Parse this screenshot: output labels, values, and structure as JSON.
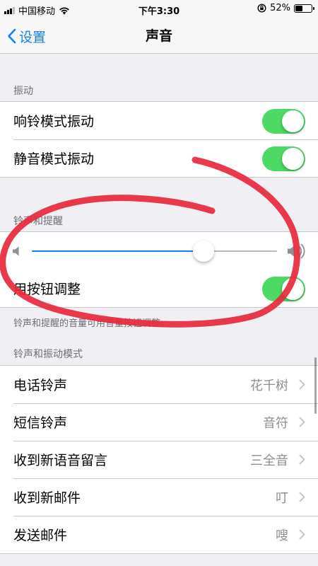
{
  "status_bar": {
    "carrier": "中国移动",
    "time": "下午3:30",
    "battery_percent": "52%",
    "battery_level": 0.52
  },
  "nav": {
    "back_label": "设置",
    "title": "声音"
  },
  "vibration": {
    "header": "振动",
    "items": [
      {
        "label": "响铃模式振动",
        "on": true
      },
      {
        "label": "静音模式振动",
        "on": true
      }
    ]
  },
  "ringer": {
    "header": "铃声和提醒",
    "volume_level": 0.7,
    "change_with_buttons_label": "用按钮调整",
    "change_with_buttons_on": true,
    "footer": "铃声和提醒的音量可用音量按钮调整。"
  },
  "patterns": {
    "header": "铃声和振动模式",
    "items": [
      {
        "label": "电话铃声",
        "value": "花千树"
      },
      {
        "label": "短信铃声",
        "value": "音符"
      },
      {
        "label": "收到新语音留言",
        "value": "三全音"
      },
      {
        "label": "收到新邮件",
        "value": "叮"
      },
      {
        "label": "发送邮件",
        "value": "嗖"
      }
    ]
  },
  "colors": {
    "accent": "#157efb",
    "toggle_on": "#4cd964",
    "annotation": "#e8283c"
  }
}
